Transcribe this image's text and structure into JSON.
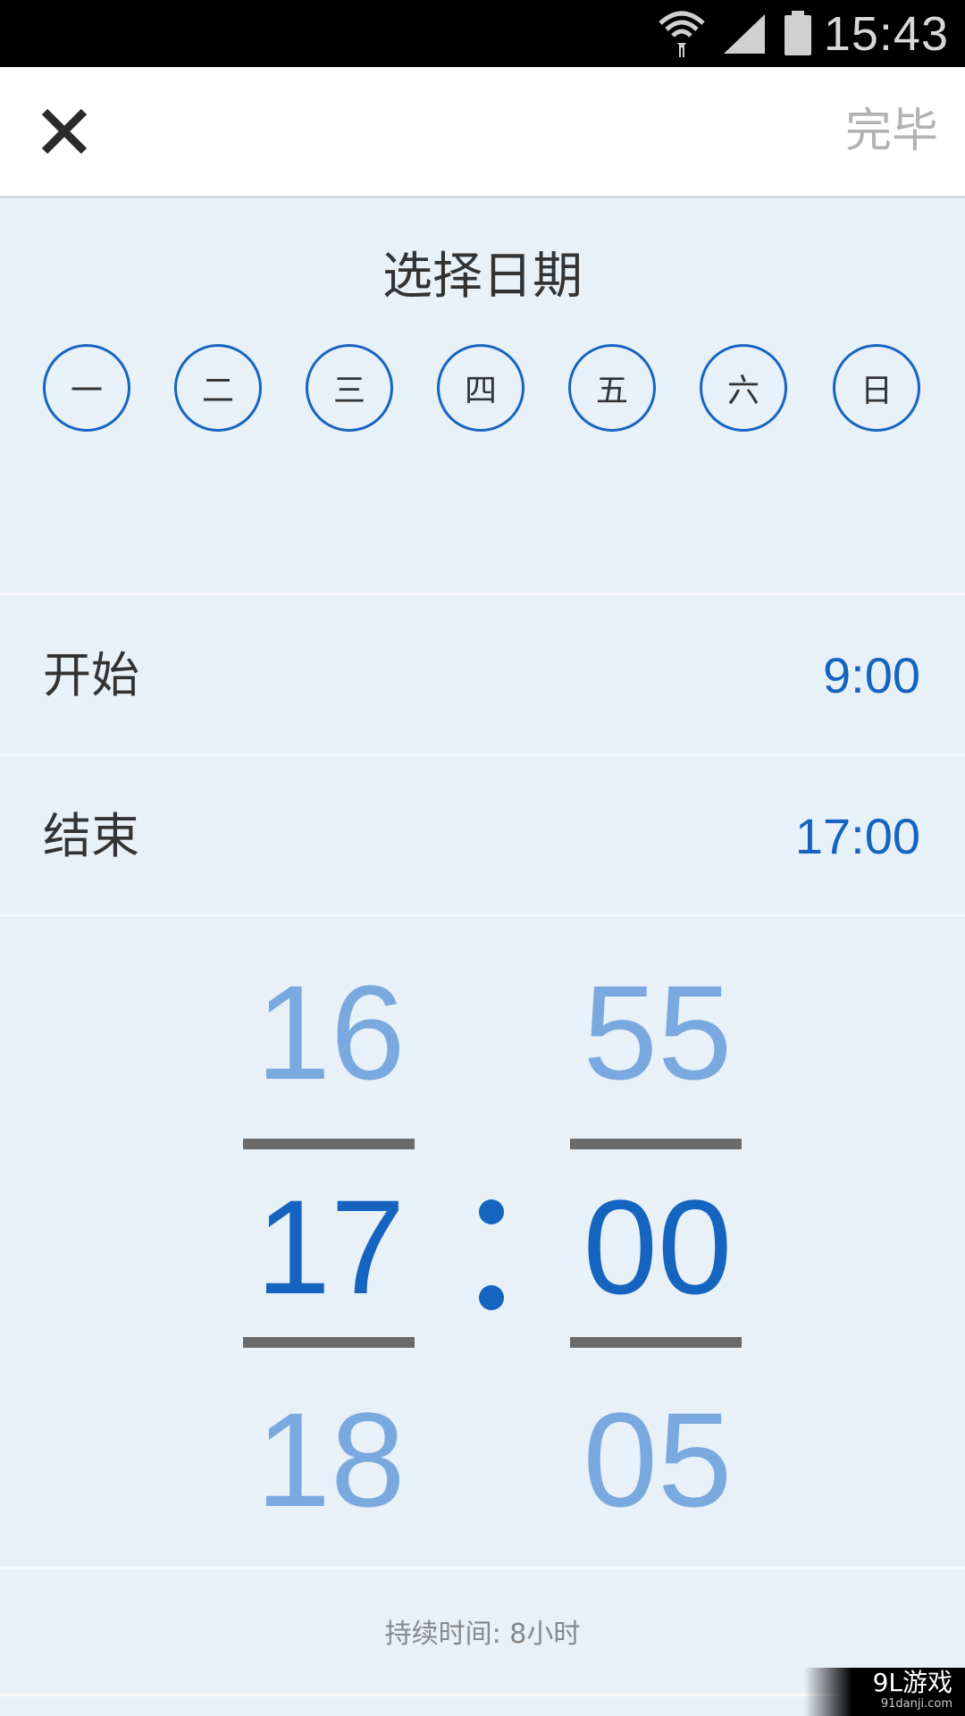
{
  "status_bar": {
    "time": "15:43",
    "icons": [
      "wifi-icon",
      "signal-icon",
      "battery-icon"
    ]
  },
  "topbar": {
    "close_icon": "close-icon",
    "done_label": "完毕"
  },
  "date_section": {
    "title": "选择日期",
    "days": [
      "一",
      "二",
      "三",
      "四",
      "五",
      "六",
      "日"
    ]
  },
  "start": {
    "label": "开始",
    "value": "9:00"
  },
  "end": {
    "label": "结束",
    "value": "17:00"
  },
  "picker": {
    "hours": {
      "prev": "16",
      "current": "17",
      "next": "18"
    },
    "minutes": {
      "prev": "55",
      "current": "00",
      "next": "05"
    }
  },
  "duration": "持续时间: 8小时",
  "watermark": {
    "brand": "9L游戏",
    "url": "91danji.com"
  },
  "colors": {
    "accent": "#1565c0",
    "background": "#e8f0f8",
    "faded": "#7aa9df"
  }
}
